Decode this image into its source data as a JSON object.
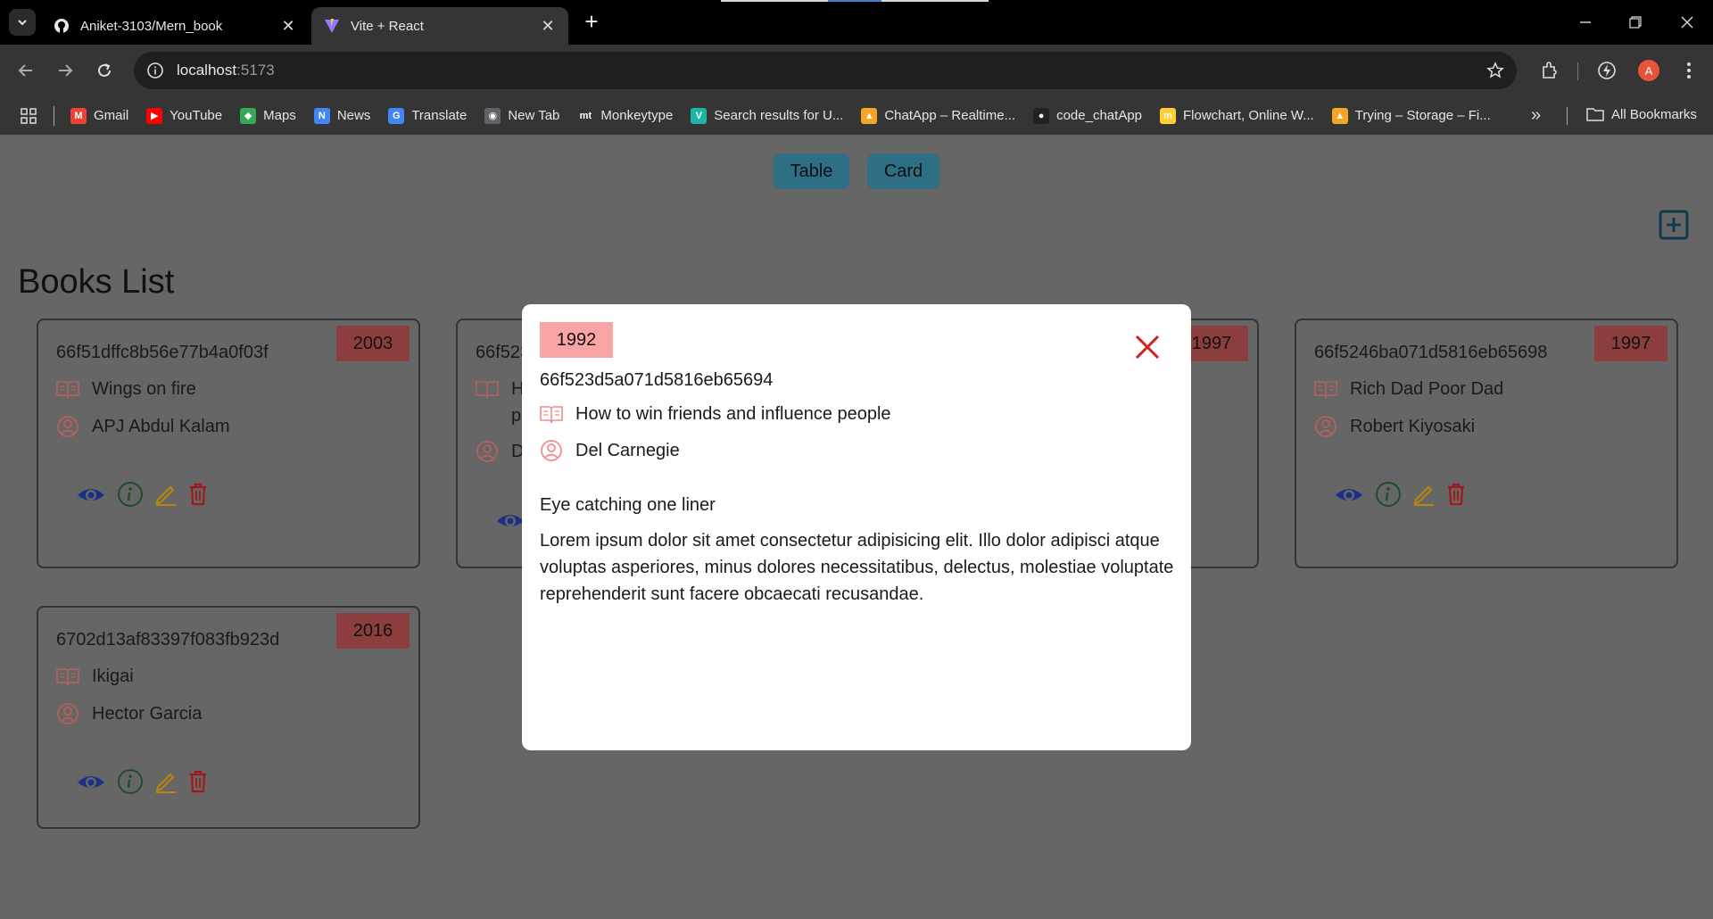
{
  "browser": {
    "tabs": [
      {
        "title": "Aniket-3103/Mern_book",
        "icon": "github-icon"
      },
      {
        "title": "Vite + React",
        "icon": "vite-icon"
      }
    ],
    "url_host": "localhost",
    "url_port": ":5173",
    "avatar_letter": "A",
    "bookmarks": [
      {
        "label": "Gmail",
        "icon": "gmail-icon",
        "color": "#ea4335",
        "glyph": "M"
      },
      {
        "label": "YouTube",
        "icon": "youtube-icon",
        "color": "#ff0000",
        "glyph": "▶"
      },
      {
        "label": "Maps",
        "icon": "maps-icon",
        "color": "#34a853",
        "glyph": "◆"
      },
      {
        "label": "News",
        "icon": "news-icon",
        "color": "#4285f4",
        "glyph": "N"
      },
      {
        "label": "Translate",
        "icon": "translate-icon",
        "color": "#4285f4",
        "glyph": "G"
      },
      {
        "label": "New Tab",
        "icon": "globe-icon",
        "color": "#5f6368",
        "glyph": "◉"
      },
      {
        "label": "Monkeytype",
        "icon": "monkeytype-icon",
        "color": "#353535",
        "glyph": "mt"
      },
      {
        "label": "Search results for U...",
        "icon": "vuetify-icon",
        "color": "#1bb7a4",
        "glyph": "V"
      },
      {
        "label": "ChatApp – Realtime...",
        "icon": "firebase-icon",
        "color": "#f5a623",
        "glyph": "▲"
      },
      {
        "label": "code_chatApp",
        "icon": "github-icon",
        "color": "#222222",
        "glyph": "●"
      },
      {
        "label": "Flowchart, Online W...",
        "icon": "miro-icon",
        "color": "#ffd02f",
        "glyph": "m"
      },
      {
        "label": "Trying – Storage – Fi...",
        "icon": "firebase-icon",
        "color": "#f5a623",
        "glyph": "▲"
      }
    ],
    "all_bookmarks_label": "All Bookmarks"
  },
  "app": {
    "toggle_table": "Table",
    "toggle_card": "Card",
    "page_title": "Books List",
    "accent_colors": {
      "year_badge": "#8c3d3d",
      "modal_badge": "#f9a5a5",
      "toggle": "#2f6f86"
    }
  },
  "books": [
    {
      "id": "66f51dffc8b56e77b4a0f03f",
      "title": "Wings on fire",
      "author": "APJ Abdul Kalam",
      "year": "2003"
    },
    {
      "id": "66f523",
      "title": "H",
      "title2": "p",
      "author": "D",
      "year": "1992"
    },
    {
      "id": "",
      "title": "",
      "author": "",
      "year": "1997"
    },
    {
      "id": "66f5246ba071d5816eb65698",
      "title": "Rich Dad Poor Dad",
      "author": "Robert Kiyosaki",
      "year": "1997"
    },
    {
      "id": "6702d13af83397f083fb923d",
      "title": "Ikigai",
      "author": "Hector Garcia",
      "year": "2016"
    }
  ],
  "modal": {
    "year": "1992",
    "id": "66f523d5a071d5816eb65694",
    "title": "How to win friends and influence people",
    "author": "Del Carnegie",
    "one_liner": "Eye catching one liner",
    "description": "Lorem ipsum dolor sit amet consectetur adipisicing elit. Illo dolor adipisci atque voluptas asperiores, minus dolores necessitatibus, delectus, molestiae voluptate reprehenderit sunt facere obcaecati recusandae."
  }
}
